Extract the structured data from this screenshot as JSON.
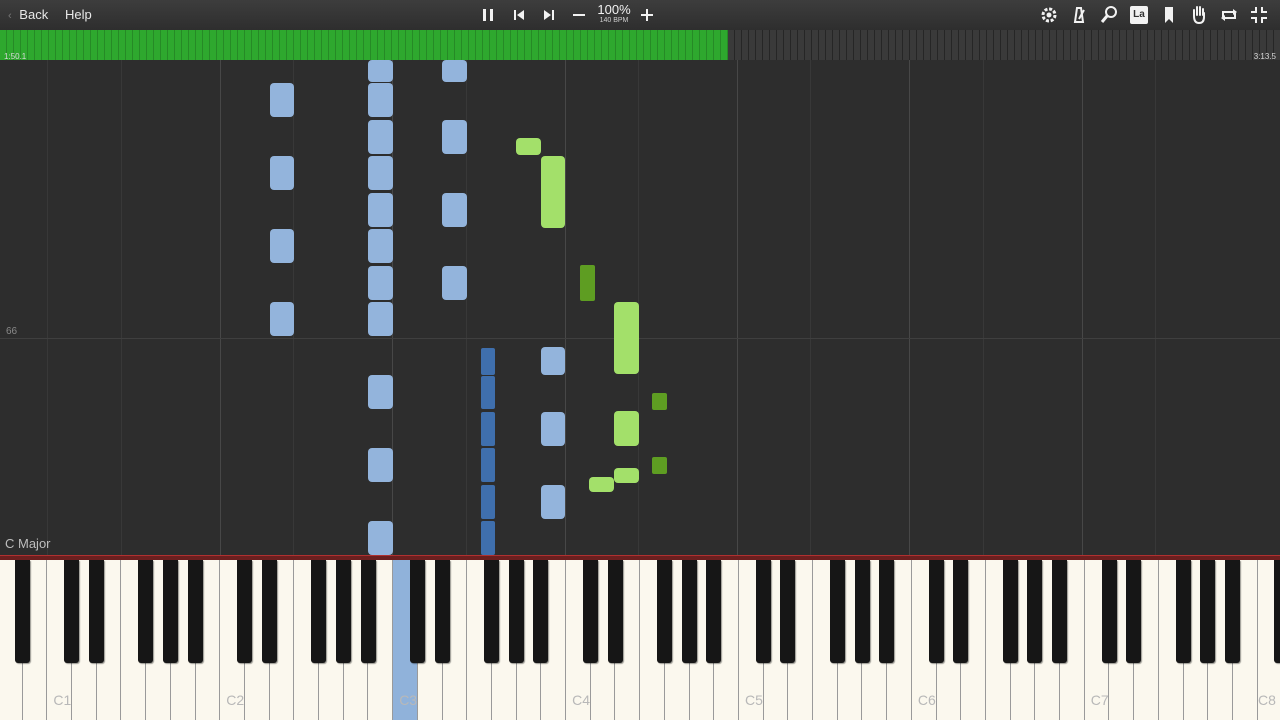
{
  "toolbar": {
    "back_label": "Back",
    "help_label": "Help",
    "zoom_percent": "100%",
    "tempo": "140 BPM",
    "icons": [
      "pause-icon",
      "previous-icon",
      "next-icon",
      "zoom-out-icon",
      "zoom-in-icon",
      "settings-icon",
      "metronome-icon",
      "search-icon",
      "label-icon",
      "bookmark-icon",
      "hand-icon",
      "loop-icon",
      "exit-fullscreen-icon"
    ],
    "label_icon_text": "La"
  },
  "progress": {
    "current_time": "1:50.1",
    "total_time": "3:13.5",
    "fraction": 0.569,
    "accent": "#2ea82e"
  },
  "roll": {
    "measure_number": "66",
    "key_signature": "C Major",
    "colors": {
      "left_hand": "#93b4dc",
      "left_hand_held": "#3f6fad",
      "right_hand": "#a3e06a",
      "right_hand_held": "#5e9d22"
    }
  },
  "keyboard": {
    "octave_labels": [
      "C1",
      "C2",
      "C3",
      "C4",
      "C5",
      "C6",
      "C7",
      "C8"
    ],
    "pressed_key": "C3"
  }
}
